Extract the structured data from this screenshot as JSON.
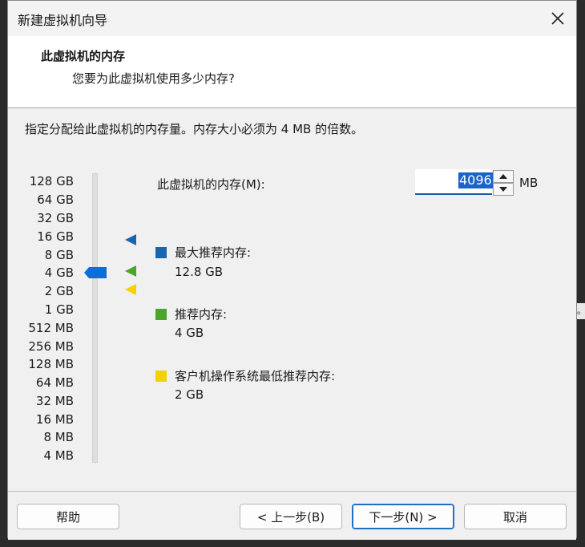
{
  "window": {
    "title": "新建虚拟机向导",
    "close_icon": "close-icon"
  },
  "header": {
    "title": "此虚拟机的内存",
    "subtitle": "您要为此虚拟机使用多少内存?"
  },
  "description": "指定分配给此虚拟机的内存量。内存大小必须为 4 MB 的倍数。",
  "scale": {
    "labels": [
      "128 GB",
      "64 GB",
      "32 GB",
      "16 GB",
      "8 GB",
      "4 GB",
      "2 GB",
      "1 GB",
      "512 MB",
      "256 MB",
      "128 MB",
      "64 MB",
      "32 MB",
      "16 MB",
      "8 MB",
      "4 MB"
    ],
    "selected": "4 GB"
  },
  "memory": {
    "label": "此虚拟机的内存(M):",
    "value": "4096",
    "unit": "MB"
  },
  "legend": [
    {
      "label": "最大推荐内存:",
      "value": "12.8 GB",
      "color": "#1966b0"
    },
    {
      "label": "推荐内存:",
      "value": "4 GB",
      "color": "#4aa52a"
    },
    {
      "label": "客户机操作系统最低推荐内存:",
      "value": "2 GB",
      "color": "#f2d200"
    }
  ],
  "buttons": {
    "help": "帮助",
    "back": "< 上一步(B)",
    "next": "下一步(N) >",
    "cancel": "取消"
  },
  "edge_glyph": "。"
}
